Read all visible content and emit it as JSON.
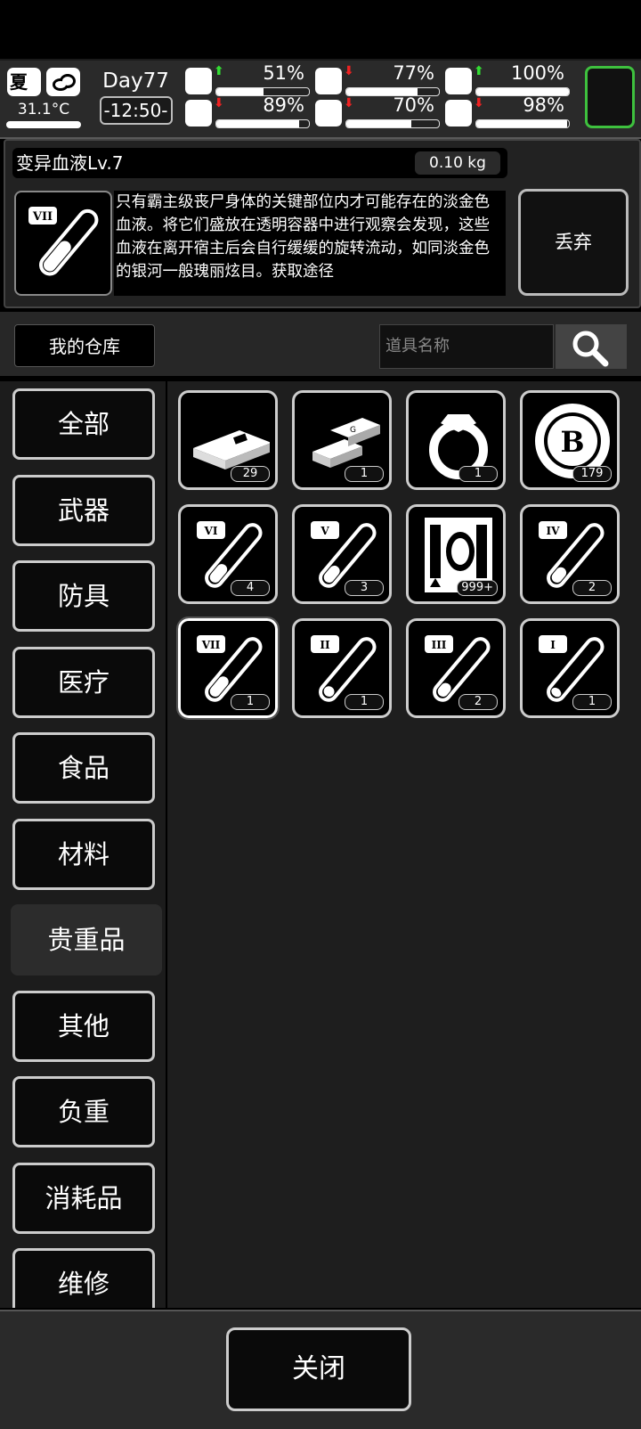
{
  "status": {
    "season": "夏",
    "temperature": "31.1°C",
    "day": "Day77",
    "time": "-12:50-",
    "stats": [
      {
        "icon": "medkit-icon",
        "trend": "up",
        "value": "51%",
        "level": 0.51
      },
      {
        "icon": "stomach-icon",
        "trend": "down",
        "value": "77%",
        "level": 0.77
      },
      {
        "icon": "pill-icon",
        "trend": "up",
        "value": "100%",
        "level": 1.0
      },
      {
        "icon": "boot-icon",
        "trend": "down",
        "value": "89%",
        "level": 0.89
      },
      {
        "icon": "water-drop-icon",
        "trend": "down",
        "value": "70%",
        "level": 0.7
      },
      {
        "icon": "heart-icon",
        "trend": "down",
        "value": "98%",
        "level": 0.98
      }
    ],
    "colors": {
      "up": "#33dd33",
      "down": "#ee2222"
    }
  },
  "item": {
    "name": "变异血液Lv.7",
    "weight": "0.10 kg",
    "description": "只有霸主级丧尸身体的关键部位内才可能存在的淡金色血液。将它们盛放在透明容器中进行观察会发现，这些血液在离开宿主后会自行缓缓的旋转流动，如同淡金色的银河一般瑰丽炫目。获取途径",
    "discard_label": "丢弃"
  },
  "storage": {
    "title": "我的仓库",
    "search_placeholder": "道具名称"
  },
  "categories": [
    "全部",
    "武器",
    "防具",
    "医疗",
    "食品",
    "材料",
    "贵重品",
    "其他",
    "负重",
    "消耗品",
    "维修"
  ],
  "selected_category": "贵重品",
  "items": [
    {
      "icon": "cash-stack-icon",
      "count": "29"
    },
    {
      "icon": "gold-bars-icon",
      "count": "1"
    },
    {
      "icon": "diamond-ring-icon",
      "count": "1"
    },
    {
      "icon": "bitcoin-icon",
      "count": "179"
    },
    {
      "icon": "blood-vial-vi-icon",
      "roman": "VI",
      "fill": 0.45,
      "count": "4"
    },
    {
      "icon": "blood-vial-v-icon",
      "roman": "V",
      "fill": 0.4,
      "count": "3"
    },
    {
      "icon": "mutant-sample-icon",
      "count": "999+"
    },
    {
      "icon": "blood-vial-iv-icon",
      "roman": "IV",
      "fill": 0.35,
      "count": "2"
    },
    {
      "icon": "blood-vial-vii-icon",
      "roman": "VII",
      "fill": 0.5,
      "count": "1",
      "selected": true
    },
    {
      "icon": "blood-vial-ii-icon",
      "roman": "II",
      "fill": 0.2,
      "count": "1"
    },
    {
      "icon": "blood-vial-iii-icon",
      "roman": "III",
      "fill": 0.3,
      "count": "2"
    },
    {
      "icon": "blood-vial-i-icon",
      "roman": "I",
      "fill": 0.15,
      "count": "1"
    }
  ],
  "footer": {
    "close_label": "关闭"
  }
}
